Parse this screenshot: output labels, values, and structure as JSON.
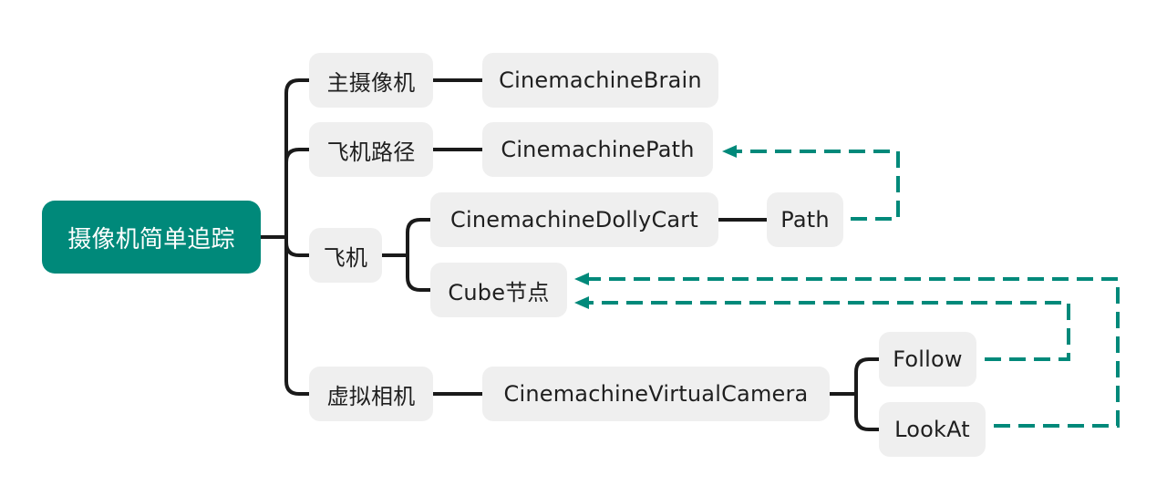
{
  "diagram": {
    "type": "mind-map",
    "accent_color": "#00897a",
    "node_color": "#efefef",
    "line_color": "#1a1a1a",
    "root": {
      "id": "root",
      "label": "摄像机简单追踪"
    },
    "nodes": [
      {
        "id": "main-camera",
        "label": "主摄像机",
        "parent": "root"
      },
      {
        "id": "cinemachine-brain",
        "label": "CinemachineBrain",
        "parent": "main-camera"
      },
      {
        "id": "plane-path",
        "label": "飞机路径",
        "parent": "root"
      },
      {
        "id": "cinemachine-path",
        "label": "CinemachinePath",
        "parent": "plane-path"
      },
      {
        "id": "plane",
        "label": "飞机",
        "parent": "root"
      },
      {
        "id": "dolly-cart",
        "label": "CinemachineDollyCart",
        "parent": "plane"
      },
      {
        "id": "path",
        "label": "Path",
        "parent": "dolly-cart"
      },
      {
        "id": "cube-node",
        "label": "Cube节点",
        "parent": "plane"
      },
      {
        "id": "virtual-camera",
        "label": "虚拟相机",
        "parent": "root"
      },
      {
        "id": "cinemachine-virtual-camera",
        "label": "CinemachineVirtualCamera",
        "parent": "virtual-camera"
      },
      {
        "id": "follow",
        "label": "Follow",
        "parent": "cinemachine-virtual-camera"
      },
      {
        "id": "lookat",
        "label": "LookAt",
        "parent": "cinemachine-virtual-camera"
      }
    ],
    "references": [
      {
        "from": "path",
        "to": "cinemachine-path",
        "style": "dashed-arrow"
      },
      {
        "from": "follow",
        "to": "cube-node",
        "style": "dashed-arrow"
      },
      {
        "from": "lookat",
        "to": "cube-node",
        "style": "dashed-arrow"
      }
    ]
  }
}
